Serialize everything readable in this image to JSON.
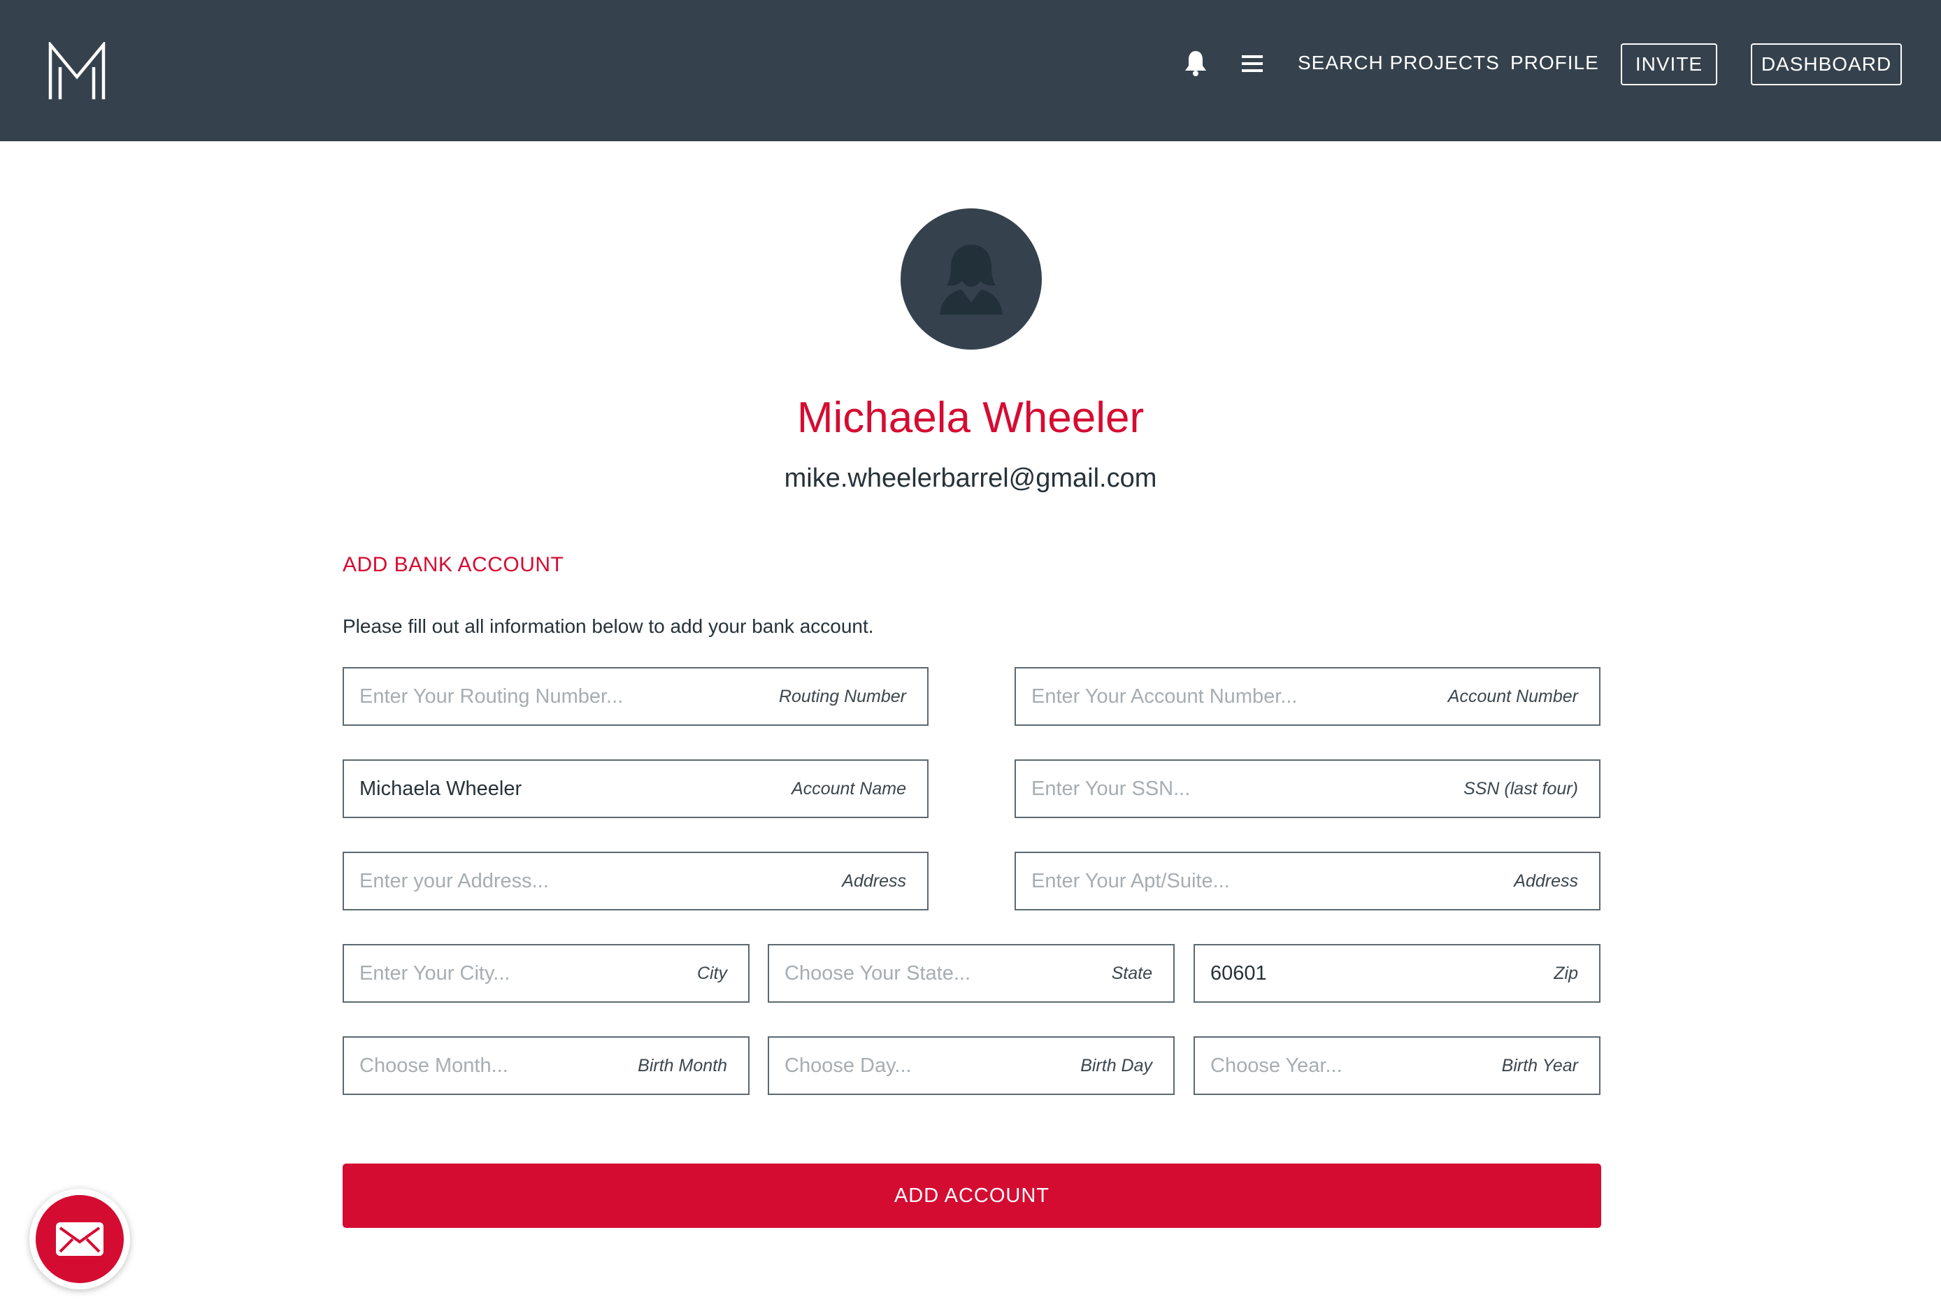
{
  "header": {
    "logo_icon": "m-logo-icon",
    "notifications_icon": "bell-icon",
    "menu_icon": "hamburger-menu-icon",
    "nav_links": {
      "search_projects": "SEARCH PROJECTS",
      "profile": "PROFILE",
      "invite": "INVITE",
      "dashboard": "DASHBOARD"
    },
    "background_color": "#35424d"
  },
  "profile": {
    "avatar_icon": "user-silhouette-icon",
    "name": "Michaela Wheeler",
    "email": "mike.wheelerbarrel@gmail.com"
  },
  "form": {
    "title": "ADD BANK ACCOUNT",
    "instructions": "Please fill out all information below to add your bank account.",
    "fields": {
      "routing_number": {
        "placeholder": "Enter Your Routing Number...",
        "value": "",
        "label": "Routing Number"
      },
      "account_number": {
        "placeholder": "Enter Your Account Number...",
        "value": "",
        "label": "Account Number"
      },
      "account_name": {
        "placeholder": "",
        "value": "Michaela Wheeler",
        "label": "Account Name"
      },
      "ssn": {
        "placeholder": "Enter Your SSN...",
        "value": "",
        "label": "SSN (last four)"
      },
      "address": {
        "placeholder": "Enter your Address...",
        "value": "",
        "label": "Address"
      },
      "apt_suite": {
        "placeholder": "Enter Your Apt/Suite...",
        "value": "",
        "label": "Address"
      },
      "city": {
        "placeholder": "Enter Your City...",
        "value": "",
        "label": "City"
      },
      "state": {
        "placeholder": "Choose Your State...",
        "value": "",
        "label": "State"
      },
      "zip": {
        "placeholder": "",
        "value": "60601",
        "label": "Zip"
      },
      "birth_month": {
        "placeholder": "Choose Month...",
        "value": "",
        "label": "Birth Month"
      },
      "birth_day": {
        "placeholder": "Choose Day...",
        "value": "",
        "label": "Birth Day"
      },
      "birth_year": {
        "placeholder": "Choose Year...",
        "value": "",
        "label": "Birth Year"
      }
    },
    "submit_label": "ADD ACCOUNT"
  },
  "fab": {
    "icon": "envelope-icon"
  },
  "colors": {
    "accent": "#d50c32",
    "header": "#35424d",
    "text": "#263238",
    "placeholder": "#a7adb1",
    "border": "#5d6970"
  }
}
